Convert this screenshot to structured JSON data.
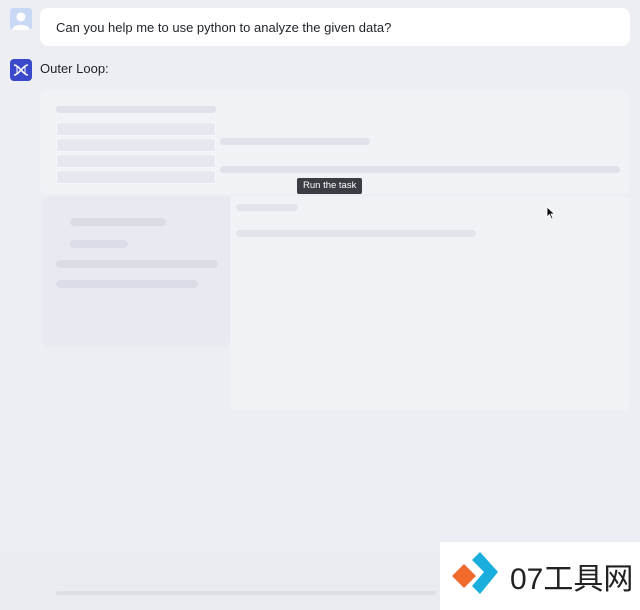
{
  "user_message": {
    "text": "Can you help me to use python to analyze the given data?",
    "avatar_icon": "user-avatar-icon"
  },
  "assistant": {
    "name": "Outer Loop:",
    "logo_icon": "dna-logo-icon",
    "logo_color": "#3949c9"
  },
  "tooltip": {
    "text": "Run the task"
  },
  "cursor_icon": "arrow-cursor-icon",
  "watermark": {
    "text": "07工具网",
    "colors": [
      "#f26a2e",
      "#1aaedc"
    ]
  }
}
